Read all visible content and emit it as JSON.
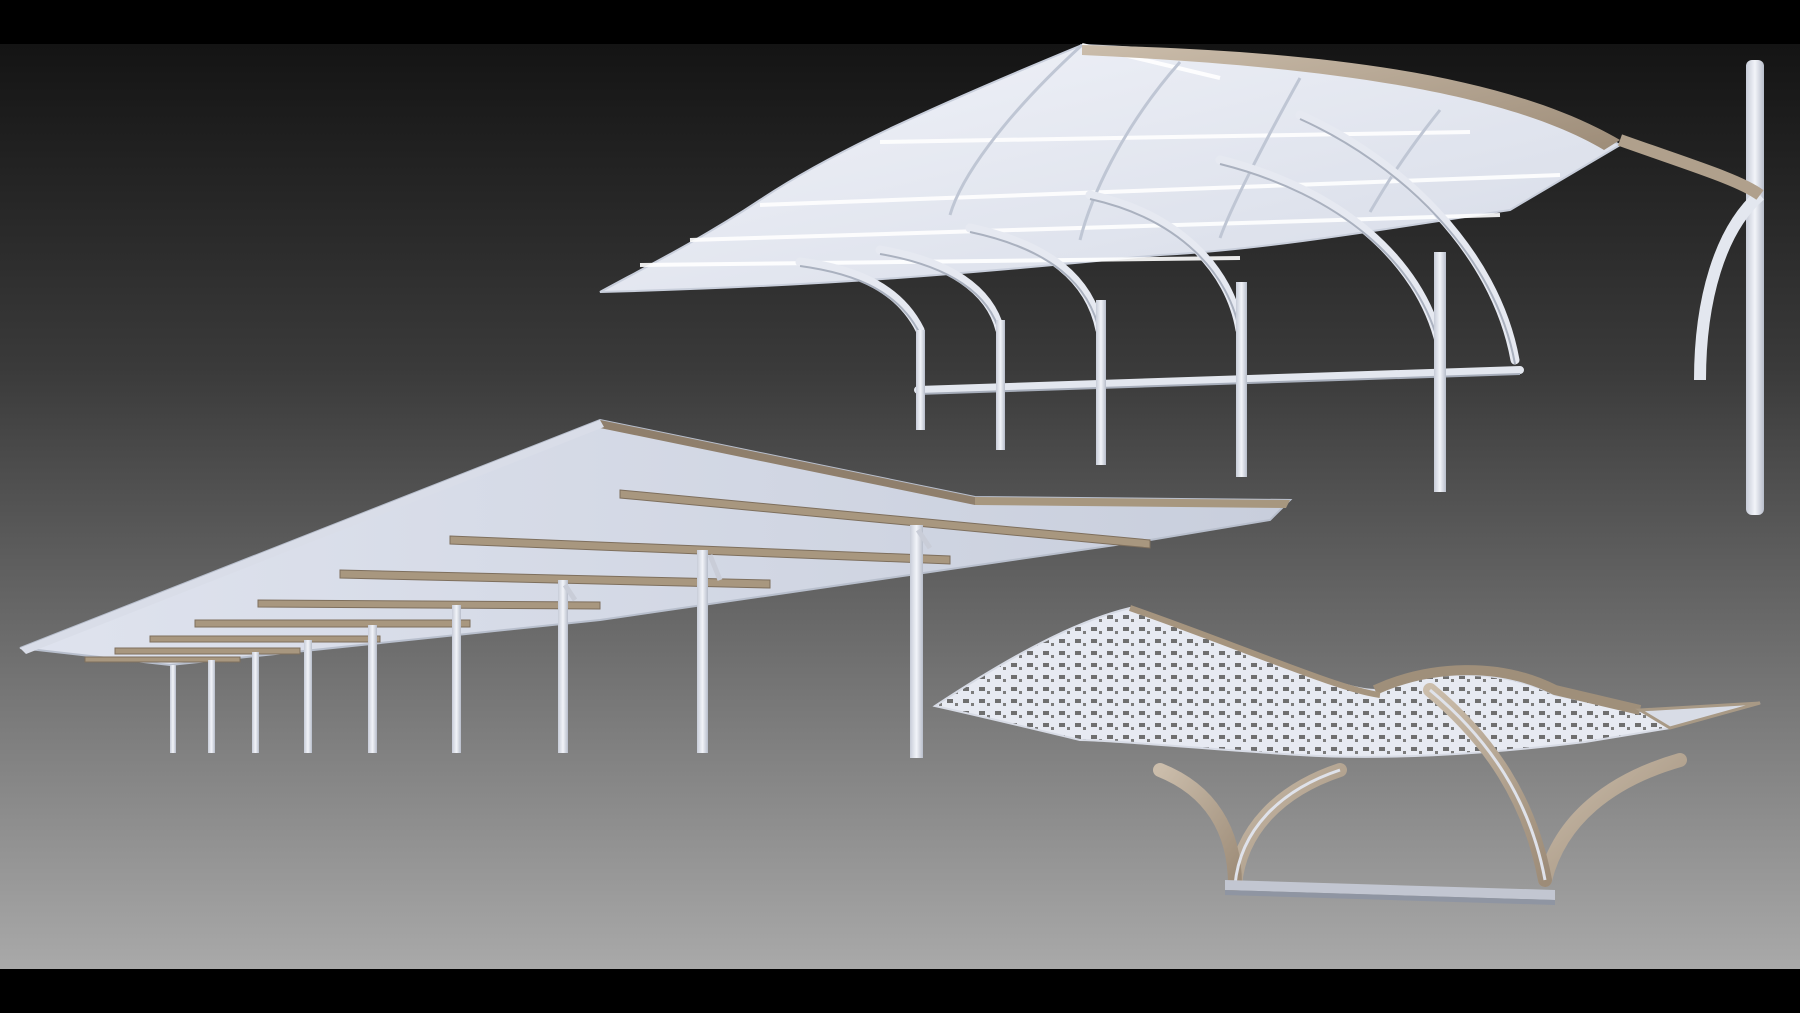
{
  "scene": {
    "background_top": "#151515",
    "background_bottom": "#a7a7a7",
    "membrane_color": "#e4e8f3",
    "frame_color": "#b9a996",
    "frame_shadow": "#8d7e6c",
    "steel_color": "#dfe3ec"
  },
  "models": [
    {
      "id": "arched-canopy",
      "description": ""
    },
    {
      "id": "cantilever-carport",
      "description": ""
    },
    {
      "id": "perforated-shade",
      "description": ""
    }
  ]
}
